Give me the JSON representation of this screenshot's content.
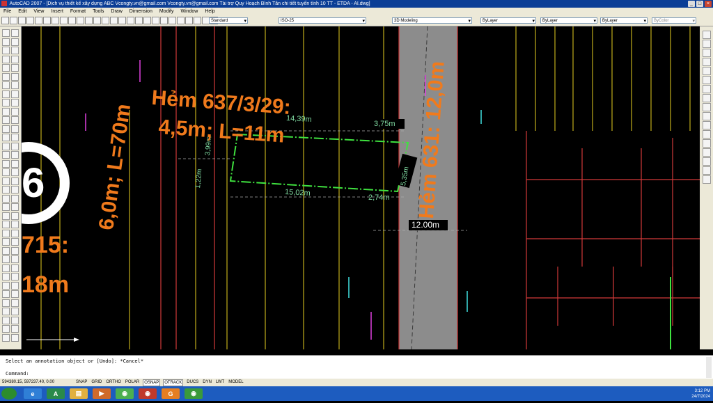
{
  "window": {
    "title": "AutoCAD 2007 - [Dịch vụ thiết kế xây dựng ABC Vcongty.vn@gmail.com Vcongty.vn@gmail.com Tài trợ Quy Hoạch Bình Tân chi tiết tuyến tính 10 TT - ETDA - AI.dwg]",
    "controls": [
      "_",
      "□",
      "×"
    ]
  },
  "menu": [
    "File",
    "Edit",
    "View",
    "Insert",
    "Format",
    "Tools",
    "Draw",
    "Dimension",
    "Modify",
    "Window",
    "Help"
  ],
  "toolbar": {
    "text_style": "Standard",
    "dim_style": "ISO-25",
    "workspace": "3D Modeling",
    "layer": "ByLayer",
    "linetype": "ByLayer",
    "lineweight": "ByLayer",
    "plotstyle": "ByColor",
    "layer_state": "☀ ○ □ ■ 0"
  },
  "drawing": {
    "labels": {
      "hem637_line1": "Hẻm 637/3/29:",
      "hem637_line2": "4,5m; L=11m",
      "left_vertical": "6,0m; L=70m",
      "hem_right_vertical": "Hẻm 631: 12,0m",
      "partial_715": "715:",
      "partial_18m": "18m",
      "partial_circle": "6"
    },
    "dimensions": {
      "top": "14,39m",
      "top_right": "3,75m",
      "bottom": "15,02m",
      "bottom_right": "2,74m",
      "left_inner": "3,99m",
      "left_outer": "1,22m",
      "right": "5,35m",
      "road": "12.00m"
    },
    "colors": {
      "orange": "#f07a1c",
      "green_outline": "#3fe23f",
      "yellow_lines": "#e8d020",
      "red_lines": "#d23a3a",
      "grey_road": "#8c8c8c",
      "dim_text": "#7fd9a0"
    }
  },
  "command": {
    "history": "Select an annotation object or [Undo]: *Cancel*",
    "prompt": "Command:"
  },
  "status": {
    "coords": "594380.15, 597237.40, 0.00",
    "modes": [
      {
        "label": "SNAP",
        "on": false
      },
      {
        "label": "GRID",
        "on": false
      },
      {
        "label": "ORTHO",
        "on": false
      },
      {
        "label": "POLAR",
        "on": false
      },
      {
        "label": "OSNAP",
        "on": true
      },
      {
        "label": "OTRACK",
        "on": true
      },
      {
        "label": "DUCS",
        "on": false
      },
      {
        "label": "DYN",
        "on": false
      },
      {
        "label": "LWT",
        "on": false
      },
      {
        "label": "MODEL",
        "on": false
      }
    ]
  },
  "taskbar": {
    "apps": [
      {
        "name": "ie",
        "glyph": "e",
        "color": "#2f7fd6"
      },
      {
        "name": "autocad",
        "glyph": "A",
        "color": "#2a8a4a"
      },
      {
        "name": "explorer",
        "glyph": "▤",
        "color": "#e0b040"
      },
      {
        "name": "media",
        "glyph": "▶",
        "color": "#d06a2a"
      },
      {
        "name": "chrome",
        "glyph": "◉",
        "color": "#4caf50"
      },
      {
        "name": "coccoc",
        "glyph": "◉",
        "color": "#c0392b"
      },
      {
        "name": "app-orange",
        "glyph": "G",
        "color": "#e67e22"
      },
      {
        "name": "chrome2",
        "glyph": "◉",
        "color": "#3a9a3a"
      }
    ],
    "time": "3:12 PM",
    "date": "24/7/2024"
  }
}
